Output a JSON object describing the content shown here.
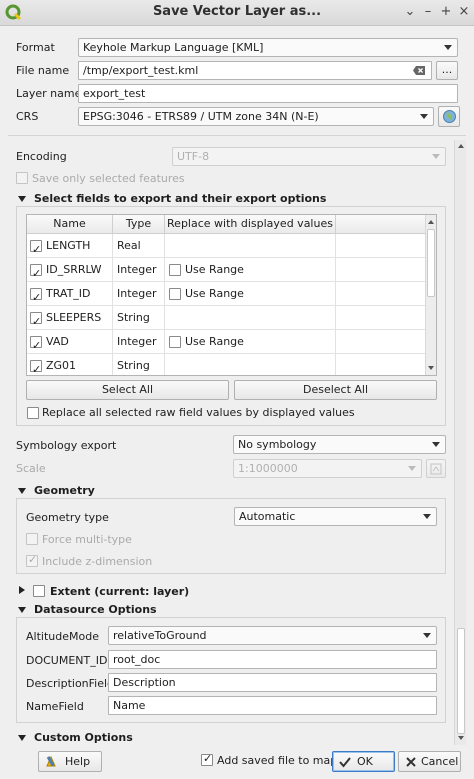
{
  "window": {
    "title": "Save Vector Layer as..."
  },
  "titlebar": {
    "collapse_glyph": "⌄",
    "minimize_glyph": "–",
    "maximize_glyph": "+",
    "close_glyph": "×"
  },
  "top": {
    "format_label": "Format",
    "format_value": "Keyhole Markup Language [KML]",
    "filename_label": "File name",
    "filename_value": "/tmp/export_test.kml",
    "browse_label": "...",
    "layername_label": "Layer name",
    "layername_value": "export_test",
    "crs_label": "CRS",
    "crs_value": "EPSG:3046 - ETRS89 / UTM zone 34N (N-E)"
  },
  "options": {
    "encoding_label": "Encoding",
    "encoding_value": "UTF-8",
    "save_selected_label": "Save only selected features",
    "fields_section_label": "Select fields to export and their export options",
    "columns": [
      "Name",
      "Type",
      "Replace with displayed values"
    ],
    "rows": [
      {
        "name": "LENGTH",
        "type": "Real",
        "checked": true,
        "use_range": false,
        "replace": ""
      },
      {
        "name": "ID_SRRLW",
        "type": "Integer",
        "checked": true,
        "use_range": true,
        "replace": "Use Range"
      },
      {
        "name": "TRAT_ID",
        "type": "Integer",
        "checked": true,
        "use_range": true,
        "replace": "Use Range"
      },
      {
        "name": "SLEEPERS",
        "type": "String",
        "checked": true,
        "use_range": false,
        "replace": ""
      },
      {
        "name": "VAD",
        "type": "Integer",
        "checked": true,
        "use_range": true,
        "replace": "Use Range"
      },
      {
        "name": "ZG01",
        "type": "String",
        "checked": true,
        "use_range": false,
        "replace": ""
      }
    ],
    "select_all_label": "Select All",
    "deselect_all_label": "Deselect All",
    "replace_all_label": "Replace all selected raw field values by displayed values",
    "symbology_label": "Symbology export",
    "symbology_value": "No symbology",
    "scale_label": "Scale",
    "scale_value": "1:1000000",
    "geometry_section_label": "Geometry",
    "geometry_type_label": "Geometry type",
    "geometry_type_value": "Automatic",
    "force_multi_label": "Force multi-type",
    "include_z_label": "Include z-dimension",
    "extent_section_label": "Extent (current: layer)",
    "datasource_section_label": "Datasource Options",
    "altitude_label": "AltitudeMode",
    "altitude_value": "relativeToGround",
    "document_id_label": "DOCUMENT_ID",
    "document_id_value": "root_doc",
    "description_field_label": "DescriptionField",
    "description_field_value": "Description",
    "name_field_label": "NameField",
    "name_field_value": "Name",
    "custom_section_label": "Custom Options"
  },
  "footer": {
    "help_label": "Help",
    "add_to_map_label": "Add saved file to map",
    "ok_label": "OK",
    "cancel_label": "Cancel"
  },
  "colors": {
    "qgis_green": "#589632",
    "qgis_yellow": "#f0c419",
    "ok_border": "#3c7bc6"
  }
}
